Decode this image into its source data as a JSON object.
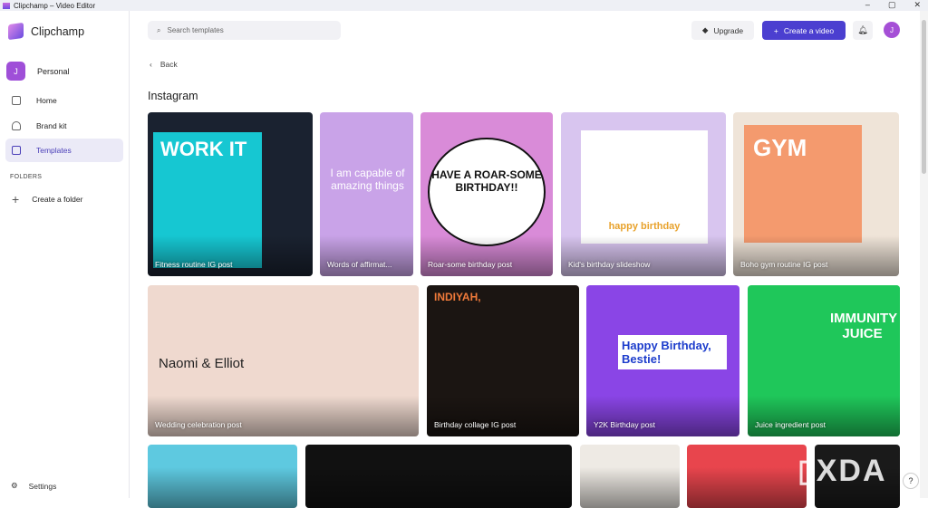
{
  "window": {
    "title": "Clipchamp – Video Editor",
    "controls": [
      "–",
      "▢",
      "✕"
    ]
  },
  "sidebar": {
    "brand": "Clipchamp",
    "account": {
      "initial": "J",
      "name": "Personal"
    },
    "items": [
      {
        "label": "Home"
      },
      {
        "label": "Brand kit"
      },
      {
        "label": "Templates"
      }
    ],
    "folders_heading": "FOLDERS",
    "create_folder": "Create a folder",
    "settings": "Settings"
  },
  "header": {
    "search_placeholder": "Search templates",
    "upgrade": "Upgrade",
    "create": "Create a video",
    "user_initial": "J"
  },
  "page": {
    "back": "Back",
    "title": "Instagram"
  },
  "templates": [
    {
      "label": "Fitness routine IG post",
      "poster": "WORK IT",
      "bg": "#1a2230"
    },
    {
      "label": "Words of affirmat...",
      "poster": "I am capable of amazing things",
      "bg": "#c9a3e8"
    },
    {
      "label": "Roar-some birthday post",
      "poster": "HAVE A ROAR-SOME BIRTHDAY!!",
      "bg": "#d98bd8"
    },
    {
      "label": "Kid's birthday slideshow",
      "poster": "happy birthday",
      "bg": "#d8c5ef"
    },
    {
      "label": "Boho gym routine IG post",
      "poster": "GYM",
      "bg": "#efe4d8"
    },
    {
      "label": "Wedding celebration post",
      "poster": "Naomi & Elliot",
      "bg": "#efd9cf"
    },
    {
      "label": "Birthday collage IG post",
      "poster": "INDIYAH,",
      "bg": "#1b1512"
    },
    {
      "label": "Y2K Birthday post",
      "poster": "Happy Birthday, Bestie!",
      "bg": "#8a45e6"
    },
    {
      "label": "Juice ingredient post",
      "poster": "IMMUNITY JUICE",
      "bg": "#1fc75a"
    }
  ],
  "row3_colors": [
    "#5ec9e0",
    "#111111",
    "#eeeae4",
    "#e8454d",
    "#1a1a1a"
  ],
  "watermark": "XDA"
}
